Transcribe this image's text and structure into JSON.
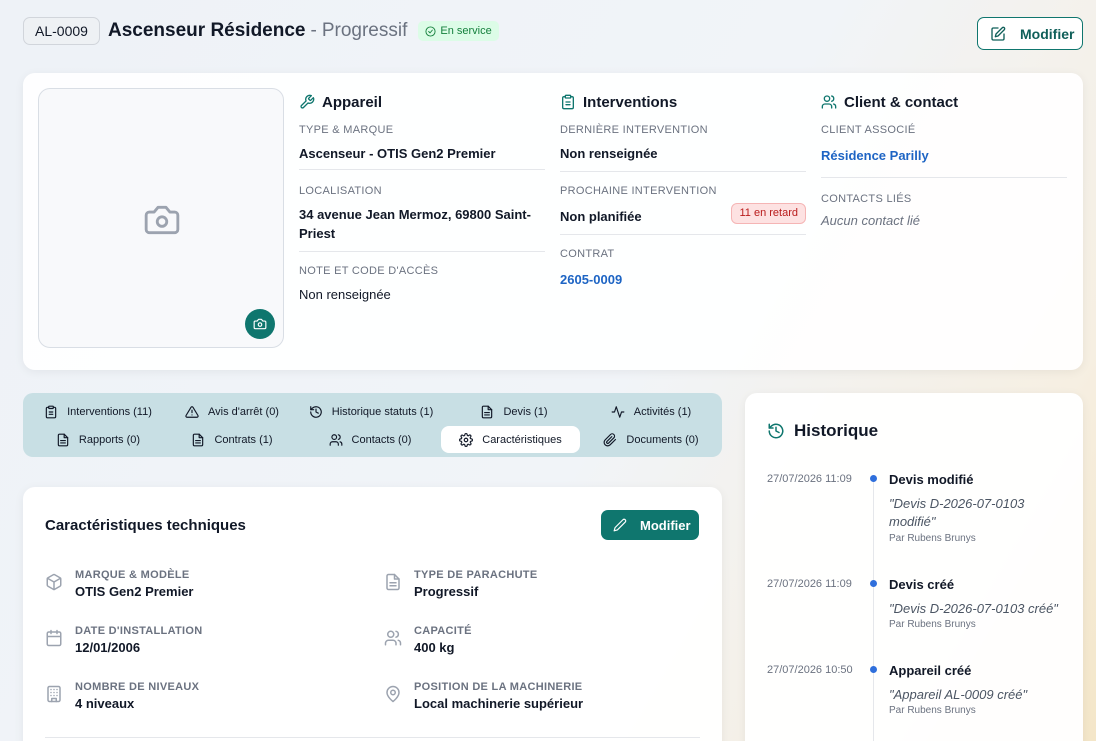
{
  "header": {
    "ref": "AL-0009",
    "title": "Ascenseur Résidence",
    "separator": "-",
    "subtitle": "Progressif",
    "status": "En service",
    "modify_label": "Modifier"
  },
  "appareil": {
    "heading": "Appareil",
    "type_label": "TYPE & MARQUE",
    "type_value": "Ascenseur - OTIS Gen2 Premier",
    "loc_label": "LOCALISATION",
    "loc_value": "34 avenue Jean Mermoz, 69800 Saint-Priest",
    "note_label": "NOTE ET CODE D'ACCÈS",
    "note_value": "Non renseignée"
  },
  "interventions": {
    "heading": "Interventions",
    "last_label": "DERNIÈRE INTERVENTION",
    "last_value": "Non renseignée",
    "next_label": "PROCHAINE INTERVENTION",
    "next_value": "Non planifiée",
    "late_badge": "11 en retard",
    "contract_label": "CONTRAT",
    "contract_value": "2605-0009"
  },
  "client": {
    "heading": "Client & contact",
    "client_label": "CLIENT ASSOCIÉ",
    "client_value": "Résidence Parilly",
    "contacts_label": "CONTACTS LIÉS",
    "contacts_value": "Aucun contact lié"
  },
  "tabs": [
    {
      "label": "Interventions (11)",
      "icon": "clipboard-icon"
    },
    {
      "label": "Avis d'arrêt (0)",
      "icon": "warning-icon"
    },
    {
      "label": "Historique statuts (1)",
      "icon": "history-icon"
    },
    {
      "label": "Devis (1)",
      "icon": "file-icon"
    },
    {
      "label": "Activités (1)",
      "icon": "activity-icon"
    },
    {
      "label": "Rapports (0)",
      "icon": "file-icon"
    },
    {
      "label": "Contrats (1)",
      "icon": "file-icon"
    },
    {
      "label": "Contacts (0)",
      "icon": "users-icon"
    },
    {
      "label": "Caractéristiques",
      "icon": "gear-icon",
      "active": true
    },
    {
      "label": "Documents (0)",
      "icon": "paperclip-icon"
    }
  ],
  "characteristics": {
    "title": "Caractéristiques techniques",
    "modify_label": "Modifier",
    "items": [
      {
        "label": "MARQUE & MODÈLE",
        "value": "OTIS Gen2 Premier",
        "icon": "box-icon"
      },
      {
        "label": "TYPE DE PARACHUTE",
        "value": "Progressif",
        "icon": "file-icon"
      },
      {
        "label": "DATE D'INSTALLATION",
        "value": "12/01/2006",
        "icon": "calendar-icon"
      },
      {
        "label": "CAPACITÉ",
        "value": "400 kg",
        "icon": "users-icon"
      },
      {
        "label": "NOMBRE DE NIVEAUX",
        "value": "4 niveaux",
        "icon": "building-icon"
      },
      {
        "label": "POSITION DE LA MACHINERIE",
        "value": "Local machinerie supérieur",
        "icon": "map-pin-icon"
      }
    ]
  },
  "history": {
    "title": "Historique",
    "events": [
      {
        "date": "27/07/2026 11:09",
        "title": "Devis modifié",
        "desc": "\"Devis D-2026-07-0103 modifié\"",
        "by": "Par Rubens Brunys"
      },
      {
        "date": "27/07/2026 11:09",
        "title": "Devis créé",
        "desc": "\"Devis D-2026-07-0103 créé\"",
        "by": "Par Rubens Brunys"
      },
      {
        "date": "27/07/2026 10:50",
        "title": "Appareil créé",
        "desc": "\"Appareil AL-0009 créé\"",
        "by": "Par Rubens Brunys"
      }
    ]
  },
  "colors": {
    "accent": "#0f766e",
    "link": "#1d64c4",
    "success": "#15803d",
    "danger": "#b91c1c"
  }
}
